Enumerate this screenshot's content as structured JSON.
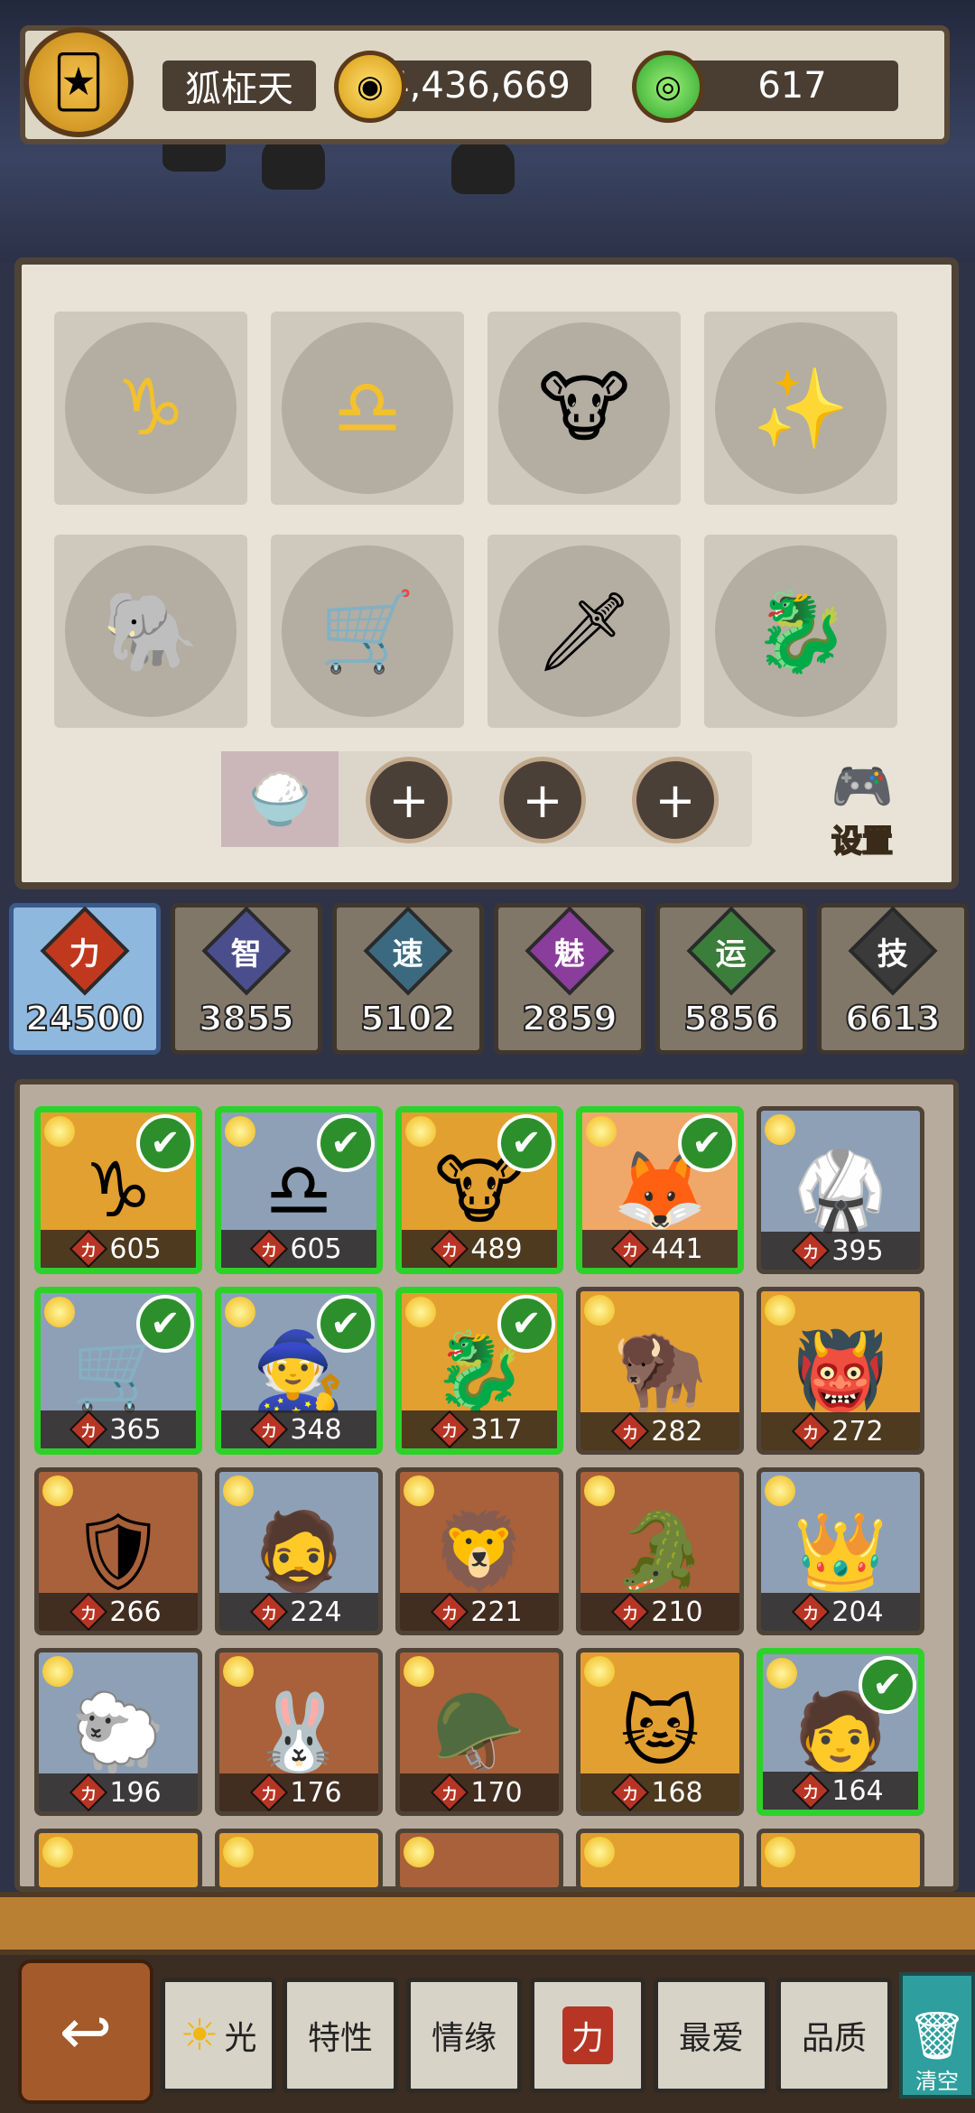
{
  "player": {
    "name": "狐柾天",
    "gold": "4,436,669",
    "gems": "617"
  },
  "team": {
    "slots": [
      {
        "kind": "zodiac",
        "glyph": "♑"
      },
      {
        "kind": "zodiac",
        "glyph": "♎"
      },
      {
        "kind": "hero",
        "glyph": "🐮"
      },
      {
        "kind": "hero",
        "glyph": "✨"
      },
      {
        "kind": "hero",
        "glyph": "🐘"
      },
      {
        "kind": "hero",
        "glyph": "🛒"
      },
      {
        "kind": "hero",
        "glyph": "🗡"
      },
      {
        "kind": "hero",
        "glyph": "🐉"
      }
    ],
    "pet_icon": "rice-bowl-icon",
    "add_symbol": "+",
    "settings_label": "设置"
  },
  "stats": [
    {
      "key": "力",
      "value": "24500",
      "color": "#c0391f",
      "active": true
    },
    {
      "key": "智",
      "value": "3855",
      "color": "#4b4e8c",
      "active": false
    },
    {
      "key": "速",
      "value": "5102",
      "color": "#3b6a80",
      "active": false
    },
    {
      "key": "魅",
      "value": "2859",
      "color": "#8a3d9a",
      "active": false
    },
    {
      "key": "运",
      "value": "5856",
      "color": "#3b7d3b",
      "active": false
    },
    {
      "key": "技",
      "value": "6613",
      "color": "#3a3a3a",
      "active": false
    }
  ],
  "cards": [
    {
      "power": "605",
      "selected": true,
      "bg": "#e2a030",
      "art": "♑"
    },
    {
      "power": "605",
      "selected": true,
      "bg": "#8ea0b5",
      "art": "♎"
    },
    {
      "power": "489",
      "selected": true,
      "bg": "#e2a030",
      "art": "🐮"
    },
    {
      "power": "441",
      "selected": true,
      "bg": "#f0a86a",
      "art": "🦊"
    },
    {
      "power": "395",
      "selected": false,
      "bg": "#8ea0b5",
      "art": "🥋"
    },
    {
      "power": "365",
      "selected": true,
      "bg": "#8ea0b5",
      "art": "🛒"
    },
    {
      "power": "348",
      "selected": true,
      "bg": "#8ea0b5",
      "art": "🧙"
    },
    {
      "power": "317",
      "selected": true,
      "bg": "#e2a030",
      "art": "🐉"
    },
    {
      "power": "282",
      "selected": false,
      "bg": "#e2a030",
      "art": "🦬"
    },
    {
      "power": "272",
      "selected": false,
      "bg": "#e2a030",
      "art": "👹"
    },
    {
      "power": "266",
      "selected": false,
      "bg": "#a8613a",
      "art": "🛡"
    },
    {
      "power": "224",
      "selected": false,
      "bg": "#8ea0b5",
      "art": "🧔"
    },
    {
      "power": "221",
      "selected": false,
      "bg": "#a8613a",
      "art": "🦁"
    },
    {
      "power": "210",
      "selected": false,
      "bg": "#a8613a",
      "art": "🐊"
    },
    {
      "power": "204",
      "selected": false,
      "bg": "#8ea0b5",
      "art": "👑"
    },
    {
      "power": "196",
      "selected": false,
      "bg": "#8ea0b5",
      "art": "🐑"
    },
    {
      "power": "176",
      "selected": false,
      "bg": "#a8613a",
      "art": "🐰"
    },
    {
      "power": "170",
      "selected": false,
      "bg": "#a8613a",
      "art": "🪖"
    },
    {
      "power": "168",
      "selected": false,
      "bg": "#e2a030",
      "art": "🐱"
    },
    {
      "power": "164",
      "selected": true,
      "bg": "#8ea0b5",
      "art": "🧑"
    },
    {
      "power": "",
      "selected": false,
      "bg": "#e2a030",
      "art": ""
    },
    {
      "power": "",
      "selected": false,
      "bg": "#e2a030",
      "art": ""
    },
    {
      "power": "",
      "selected": false,
      "bg": "#a8613a",
      "art": ""
    },
    {
      "power": "",
      "selected": false,
      "bg": "#e2a030",
      "art": ""
    },
    {
      "power": "",
      "selected": false,
      "bg": "#e2a030",
      "art": ""
    }
  ],
  "card_stat_glyph": "力",
  "check_glyph": "✔",
  "bottom": {
    "back_glyph": "↩",
    "filters": [
      "光",
      "特性",
      "情缘",
      "力",
      "最爱",
      "品质"
    ],
    "clear_label": "清空"
  }
}
